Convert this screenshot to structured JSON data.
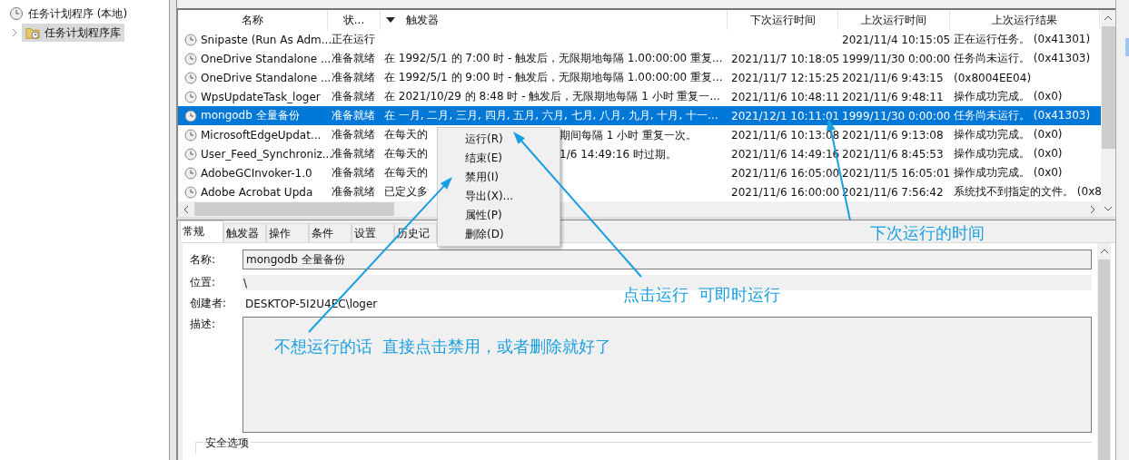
{
  "tree": [
    {
      "label": "任务计划程序 (本地)",
      "selected": false,
      "children": [
        {
          "label": "任务计划程序库",
          "selected": true,
          "expanded": false
        }
      ]
    }
  ],
  "table": {
    "columns": [
      "名称",
      "状...",
      "触发器",
      "下次运行时间",
      "上次运行时间",
      "上次运行结果"
    ],
    "rows": [
      {
        "name": "Snipaste (Run As Adm...",
        "status": "正在运行",
        "trigger": "",
        "next_run": "",
        "last_run": "2021/11/4 10:15:05",
        "result": "正在运行任务。 (0x41301)",
        "selected": false
      },
      {
        "name": "OneDrive Standalone ...",
        "status": "准备就绪",
        "trigger": "在 1992/5/1 的 7:00 时 - 触发后，无限期地每隔 1.00:00:00 重复...",
        "next_run": "2021/11/7 10:18:05",
        "last_run": "1999/11/30 0:00:00",
        "result": "任务尚未运行。 (0x41303)",
        "selected": false
      },
      {
        "name": "OneDrive Standalone ...",
        "status": "准备就绪",
        "trigger": "在 1992/5/1 的 9:00 时 - 触发后，无限期地每隔 1.00:00:00 重复...",
        "next_run": "2021/11/7 12:15:25",
        "last_run": "2021/11/6 9:43:15",
        "result": "(0x8004EE04)",
        "selected": false
      },
      {
        "name": "WpsUpdateTask_loger",
        "status": "准备就绪",
        "trigger": "在 2021/10/29 的 8:48 时 - 触发后，无限期地每隔 1 小时 重复一...",
        "next_run": "2021/11/6 10:48:11",
        "last_run": "2021/11/6 9:48:11",
        "result": "操作成功完成。 (0x0)",
        "selected": false
      },
      {
        "name": "mongodb 全量备份",
        "status": "准备就绪",
        "trigger": "在 一月, 二月, 三月, 四月, 五月, 六月, 七月, 八月, 九月, 十月, 十一...",
        "next_run": "2021/12/1 10:11:01",
        "last_run": "1999/11/30 0:00:00",
        "result": "任务尚未运行。 (0x41303)",
        "selected": true
      },
      {
        "name": "MicrosoftEdgeUpdat...",
        "status": "准备就绪",
        "trigger": "在每天的",
        "trigger_tail": "期间每隔 1 小时 重复一次。",
        "next_run": "2021/11/6 10:13:08",
        "last_run": "2021/11/6 9:13:08",
        "result": "操作成功完成。 (0x0)",
        "selected": false
      },
      {
        "name": "User_Feed_Synchroniz...",
        "status": "准备就绪",
        "trigger": "在每天的",
        "trigger_tail": "1/6 14:49:16 时过期。",
        "next_run": "2021/11/6 14:49:16",
        "last_run": "2021/11/6 8:45:53",
        "result": "操作成功完成。 (0x0)",
        "selected": false
      },
      {
        "name": "AdobeGCInvoker-1.0",
        "status": "准备就绪",
        "trigger": "在每天的",
        "next_run": "2021/11/6 16:05:00",
        "last_run": "2021/11/5 16:05:01",
        "result": "操作成功完成。 (0x0)",
        "selected": false
      },
      {
        "name": "Adobe Acrobat Upda",
        "status": "准备就绪",
        "trigger": "已定义多",
        "next_run": "2021/11/6 16:00:00",
        "last_run": "2021/11/6 7:56:42",
        "result": "系统找不到指定的文件。 (0x8",
        "selected": false
      }
    ]
  },
  "context_menu": [
    "运行(R)",
    "结束(E)",
    "禁用(I)",
    "导出(X)...",
    "属性(P)",
    "删除(D)"
  ],
  "tabs": [
    {
      "label": "常规",
      "selected": true
    },
    {
      "label": "触发器",
      "selected": false
    },
    {
      "label": "操作",
      "selected": false
    },
    {
      "label": "条件",
      "selected": false
    },
    {
      "label": "设置",
      "selected": false
    },
    {
      "label": "历史记",
      "selected": false
    }
  ],
  "general": {
    "name_label": "名称:",
    "name_value": "mongodb 全量备份",
    "location_label": "位置:",
    "location_value": "\\",
    "author_label": "创建者:",
    "author_value": "DESKTOP-5I2U4EC\\loger",
    "description_label": "描述:",
    "security_group": "安全选项"
  },
  "annotations": [
    "下次运行的时间",
    "点击运行  可即时运行",
    "不想运行的话  直接点击禁用，或者删除就好了"
  ]
}
